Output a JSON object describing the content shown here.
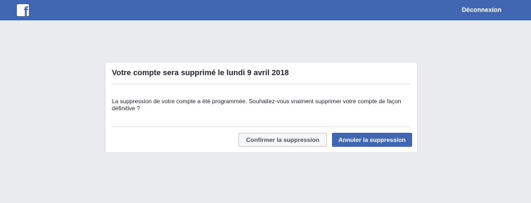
{
  "header": {
    "logo_letter": "f",
    "logout_label": "Déconnexion"
  },
  "dialog": {
    "title": "Votre compte sera supprimé le lundi 9 avril 2018",
    "body": "La suppression de votre compte a été programmée. Souhaitez-vous vraiment supprimer votre compte de façon définitive ?",
    "confirm_label": "Confirmer la suppression",
    "cancel_label": "Annuler la suppression"
  },
  "colors": {
    "brand_blue": "#4267b2",
    "page_background": "#e9ebee"
  }
}
